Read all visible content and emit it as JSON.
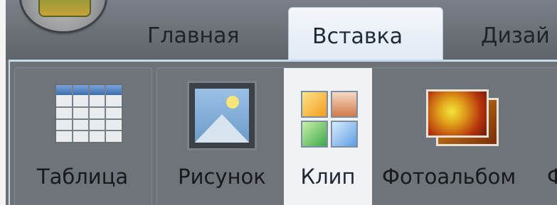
{
  "tabs": {
    "home": "Главная",
    "insert": "Вставка",
    "design": "Дизай"
  },
  "ribbon": {
    "table_label": "Таблица",
    "picture_label": "Рисунок",
    "clip_label": "Клип",
    "album_label": "Фотоальбом",
    "shapes_label_cut": "Ф"
  },
  "icons": {
    "office_button": "office-logo-icon",
    "table": "table-icon",
    "picture": "picture-icon",
    "clip": "clip-art-icon",
    "album": "photo-album-icon"
  },
  "colors": {
    "active_tab": "#e6edf6",
    "ribbon_bg": "#6d7178",
    "clip_highlight": "#f0f2f5"
  }
}
